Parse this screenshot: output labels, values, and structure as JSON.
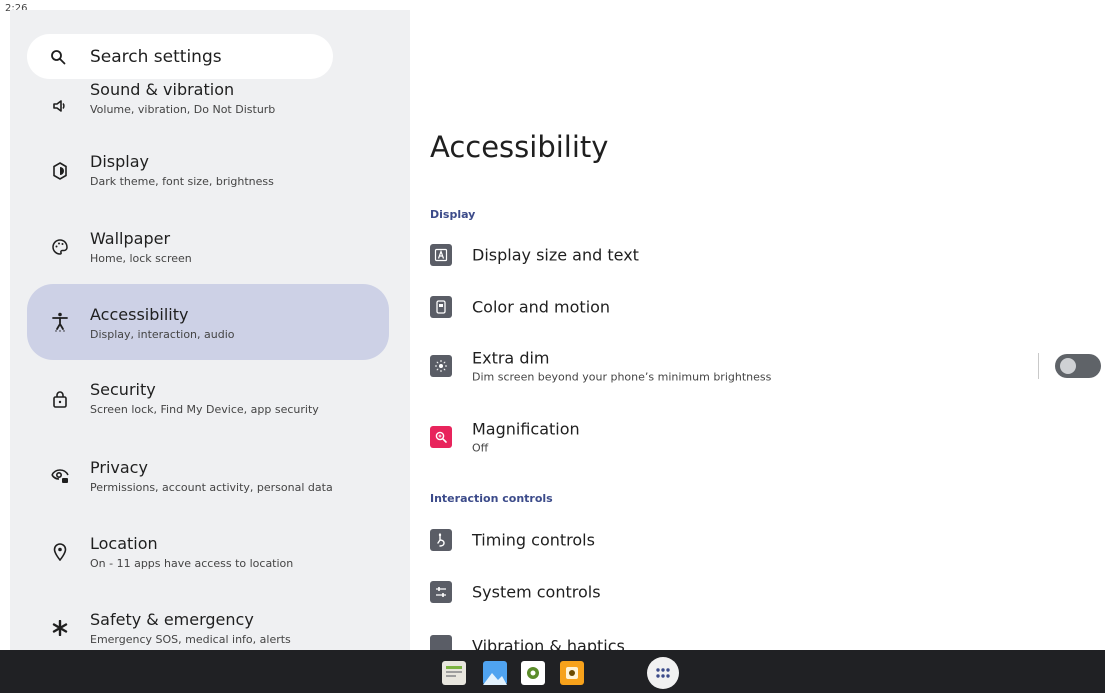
{
  "status": {
    "time": "2:26"
  },
  "search": {
    "placeholder": "Search settings"
  },
  "sidebar": {
    "items": [
      {
        "title": "Sound & vibration",
        "subtitle": "Volume, vibration, Do Not Disturb",
        "icon": "volume-icon"
      },
      {
        "title": "Display",
        "subtitle": "Dark theme, font size, brightness",
        "icon": "brightness-icon"
      },
      {
        "title": "Wallpaper",
        "subtitle": "Home, lock screen",
        "icon": "palette-icon"
      },
      {
        "title": "Accessibility",
        "subtitle": "Display, interaction, audio",
        "icon": "accessibility-icon",
        "active": true
      },
      {
        "title": "Security",
        "subtitle": "Screen lock, Find My Device, app security",
        "icon": "lock-icon"
      },
      {
        "title": "Privacy",
        "subtitle": "Permissions, account activity, personal data",
        "icon": "privacy-eye-icon"
      },
      {
        "title": "Location",
        "subtitle": "On - 11 apps have access to location",
        "icon": "location-pin-icon"
      },
      {
        "title": "Safety & emergency",
        "subtitle": "Emergency SOS, medical info, alerts",
        "icon": "asterisk-icon"
      }
    ]
  },
  "main": {
    "title": "Accessibility",
    "sections": [
      {
        "label": "Display",
        "rows": [
          {
            "title": "Display size and text",
            "icon": "text-size-icon"
          },
          {
            "title": "Color and motion",
            "icon": "color-motion-icon"
          },
          {
            "title": "Extra dim",
            "subtitle": "Dim screen beyond your phone’s minimum brightness",
            "icon": "extra-dim-icon",
            "toggle": false
          },
          {
            "title": "Magnification",
            "subtitle": "Off",
            "icon": "magnify-icon"
          }
        ]
      },
      {
        "label": "Interaction controls",
        "rows": [
          {
            "title": "Timing controls",
            "icon": "timing-icon"
          },
          {
            "title": "System controls",
            "icon": "sliders-icon"
          },
          {
            "title": "Vibration & haptics",
            "icon": "vibration-icon"
          }
        ]
      }
    ]
  },
  "taskbar": {
    "apps": [
      "files-app-icon",
      "gallery-app-icon",
      "settings-app-icon",
      "camera-app-icon",
      "app-drawer-icon"
    ]
  },
  "colors": {
    "sidebar_bg": "#eff0f2",
    "active_bg": "#cdd1e6",
    "section_label": "#3c4b8a",
    "magnification": "#e8245c",
    "taskbar": "#202124"
  }
}
